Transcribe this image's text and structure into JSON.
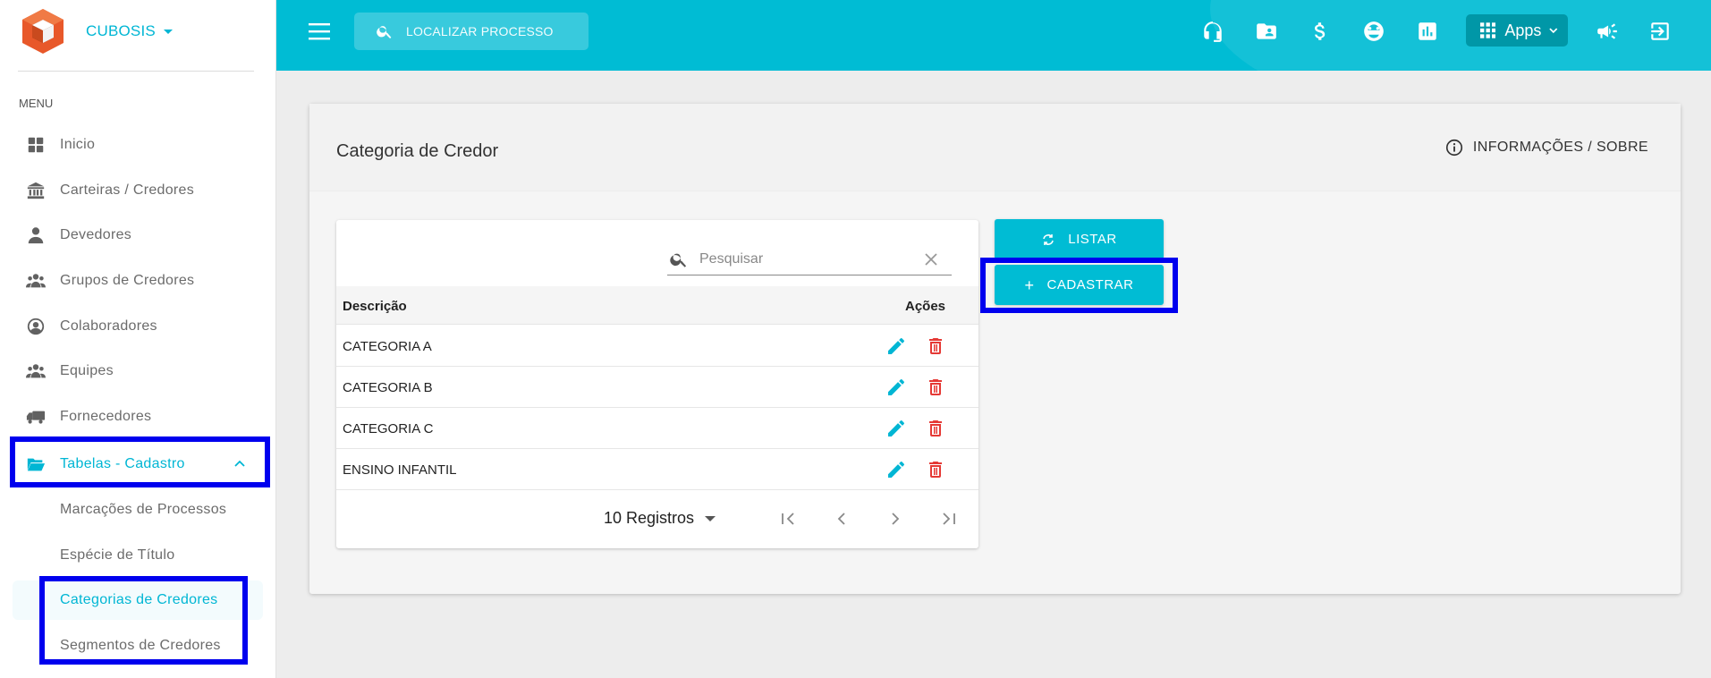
{
  "sidebar": {
    "brand": "CUBOSIS",
    "menu_title": "MENU",
    "items": [
      {
        "label": "Inicio",
        "icon": "dashboard-icon"
      },
      {
        "label": "Carteiras / Credores",
        "icon": "bank-icon"
      },
      {
        "label": "Devedores",
        "icon": "person-icon"
      },
      {
        "label": "Grupos de Credores",
        "icon": "group-icon"
      },
      {
        "label": "Colaboradores",
        "icon": "account-circle-icon"
      },
      {
        "label": "Equipes",
        "icon": "group-icon"
      },
      {
        "label": "Fornecedores",
        "icon": "truck-icon"
      },
      {
        "label": "Tabelas - Cadastro",
        "icon": "folder-open-icon"
      }
    ],
    "subitems": [
      {
        "label": "Marcações de Processos"
      },
      {
        "label": "Espécie de Título"
      },
      {
        "label": "Categorias de Credores"
      },
      {
        "label": "Segmentos de Credores"
      }
    ]
  },
  "header": {
    "search_placeholder": "LOCALIZAR PROCESSO",
    "apps_label": "Apps"
  },
  "page": {
    "title": "Categoria de Credor",
    "info_label": "INFORMAÇÕES / SOBRE"
  },
  "table": {
    "search_placeholder": "Pesquisar",
    "columns": [
      "Descrição",
      "Ações"
    ],
    "rows": [
      {
        "descricao": "CATEGORIA A"
      },
      {
        "descricao": "CATEGORIA B"
      },
      {
        "descricao": "CATEGORIA C"
      },
      {
        "descricao": "ENSINO INFANTIL"
      }
    ],
    "rows_per_page": "10 Registros"
  },
  "actions": {
    "listar": "LISTAR",
    "cadastrar": "CADASTRAR"
  },
  "colors": {
    "primary": "#00bcd4",
    "delete": "#e53935",
    "highlight": "#0000ee"
  }
}
